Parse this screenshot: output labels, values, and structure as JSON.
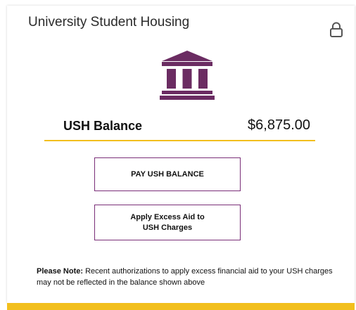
{
  "card": {
    "title": "University Student Housing"
  },
  "icons": {
    "lock": "lock-icon",
    "bank": "bank-building-icon"
  },
  "balance": {
    "label": "USH Balance",
    "amount": "$6,875.00"
  },
  "buttons": {
    "pay_label": "PAY USH BALANCE",
    "apply_line1": "Apply Excess Aid to",
    "apply_line2": "USH Charges"
  },
  "note": {
    "label": "Please Note:",
    "text": "Recent authorizations to apply excess financial aid to your USH charges may not be reflected in the balance shown above"
  },
  "colors": {
    "brand_purple": "#6b2c62",
    "accent_gold": "#f2bf1d",
    "button_border": "#7a2e78"
  }
}
